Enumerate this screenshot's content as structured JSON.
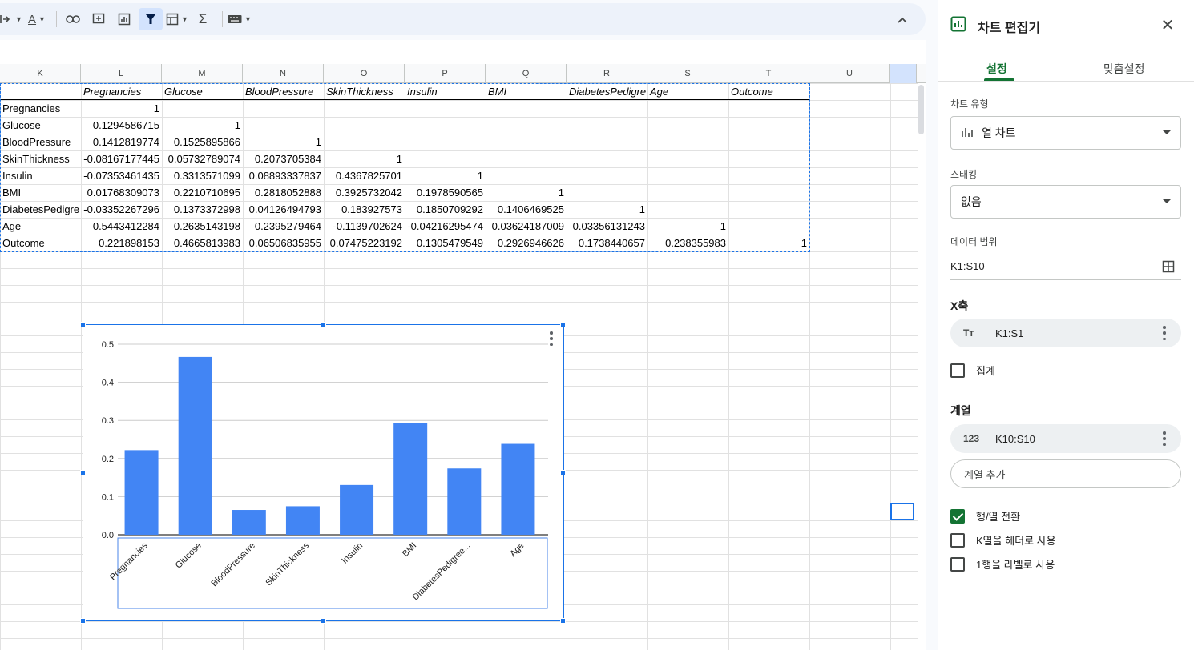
{
  "grid": {
    "columns": [
      "K",
      "L",
      "M",
      "N",
      "O",
      "P",
      "Q",
      "R",
      "S",
      "T",
      "U"
    ],
    "header_row": [
      "",
      "Pregnancies",
      "Glucose",
      "BloodPressure",
      "SkinThickness",
      "Insulin",
      "BMI",
      "DiabetesPedigre",
      "Age",
      "Outcome"
    ],
    "rows": [
      [
        "Pregnancies",
        "1",
        "",
        "",
        "",
        "",
        "",
        "",
        "",
        ""
      ],
      [
        "Glucose",
        "0.1294586715",
        "1",
        "",
        "",
        "",
        "",
        "",
        "",
        ""
      ],
      [
        "BloodPressure",
        "0.1412819774",
        "0.1525895866",
        "1",
        "",
        "",
        "",
        "",
        "",
        ""
      ],
      [
        "SkinThickness",
        "-0.08167177445",
        "0.05732789074",
        "0.2073705384",
        "1",
        "",
        "",
        "",
        "",
        ""
      ],
      [
        "Insulin",
        "-0.07353461435",
        "0.3313571099",
        "0.08893337837",
        "0.4367825701",
        "1",
        "",
        "",
        "",
        ""
      ],
      [
        "BMI",
        "0.01768309073",
        "0.2210710695",
        "0.2818052888",
        "0.3925732042",
        "0.1978590565",
        "1",
        "",
        "",
        ""
      ],
      [
        "DiabetesPedigre",
        "-0.03352267296",
        "0.1373372998",
        "0.04126494793",
        "0.183927573",
        "0.1850709292",
        "0.1406469525",
        "1",
        "",
        ""
      ],
      [
        "Age",
        "0.5443412284",
        "0.2635143198",
        "0.2395279464",
        "-0.1139702624",
        "-0.04216295474",
        "0.03624187009",
        "0.03356131243",
        "1",
        ""
      ],
      [
        "Outcome",
        "0.221898153",
        "0.4665813983",
        "0.06506835955",
        "0.07475223192",
        "0.1305479549",
        "0.2926946626",
        "0.1738440657",
        "0.238355983",
        "1"
      ]
    ]
  },
  "chart_data": {
    "type": "bar",
    "categories": [
      "Pregnancies",
      "Glucose",
      "BloodPressure",
      "SkinThickness",
      "Insulin",
      "BMI",
      "DiabetesPedigree...",
      "Age"
    ],
    "values": [
      0.221898153,
      0.4665813983,
      0.06506835955,
      0.07475223192,
      0.1305479549,
      0.2926946626,
      0.1738440657,
      0.238355983
    ],
    "title": "",
    "xlabel": "",
    "ylabel": "",
    "ylim": [
      0,
      0.5
    ],
    "yticks": [
      "0.0",
      "0.1",
      "0.2",
      "0.3",
      "0.4",
      "0.5"
    ],
    "bar_color": "#4285f4",
    "grid": true,
    "legend": "none"
  },
  "panel": {
    "title": "차트 편집기",
    "tabs": [
      "설정",
      "맞춤설정"
    ],
    "chart_type_label": "차트 유형",
    "chart_type_value": "열 차트",
    "stacking_label": "스태킹",
    "stacking_value": "없음",
    "data_range_label": "데이터 범위",
    "data_range_value": "K1:S10",
    "x_axis_title": "X축",
    "x_axis_icon": "Tт",
    "x_axis_range": "K1:S1",
    "aggregate_label": "집계",
    "series_title": "계열",
    "series_icon": "123",
    "series_range": "K10:S10",
    "add_series_label": "계열 추가",
    "checkboxes": [
      "행/열 전환",
      "K열을 헤더로 사용",
      "1행을 라벨로 사용"
    ]
  },
  "colors": {
    "accent_green": "#137333",
    "selection_blue": "#1a73e8"
  }
}
